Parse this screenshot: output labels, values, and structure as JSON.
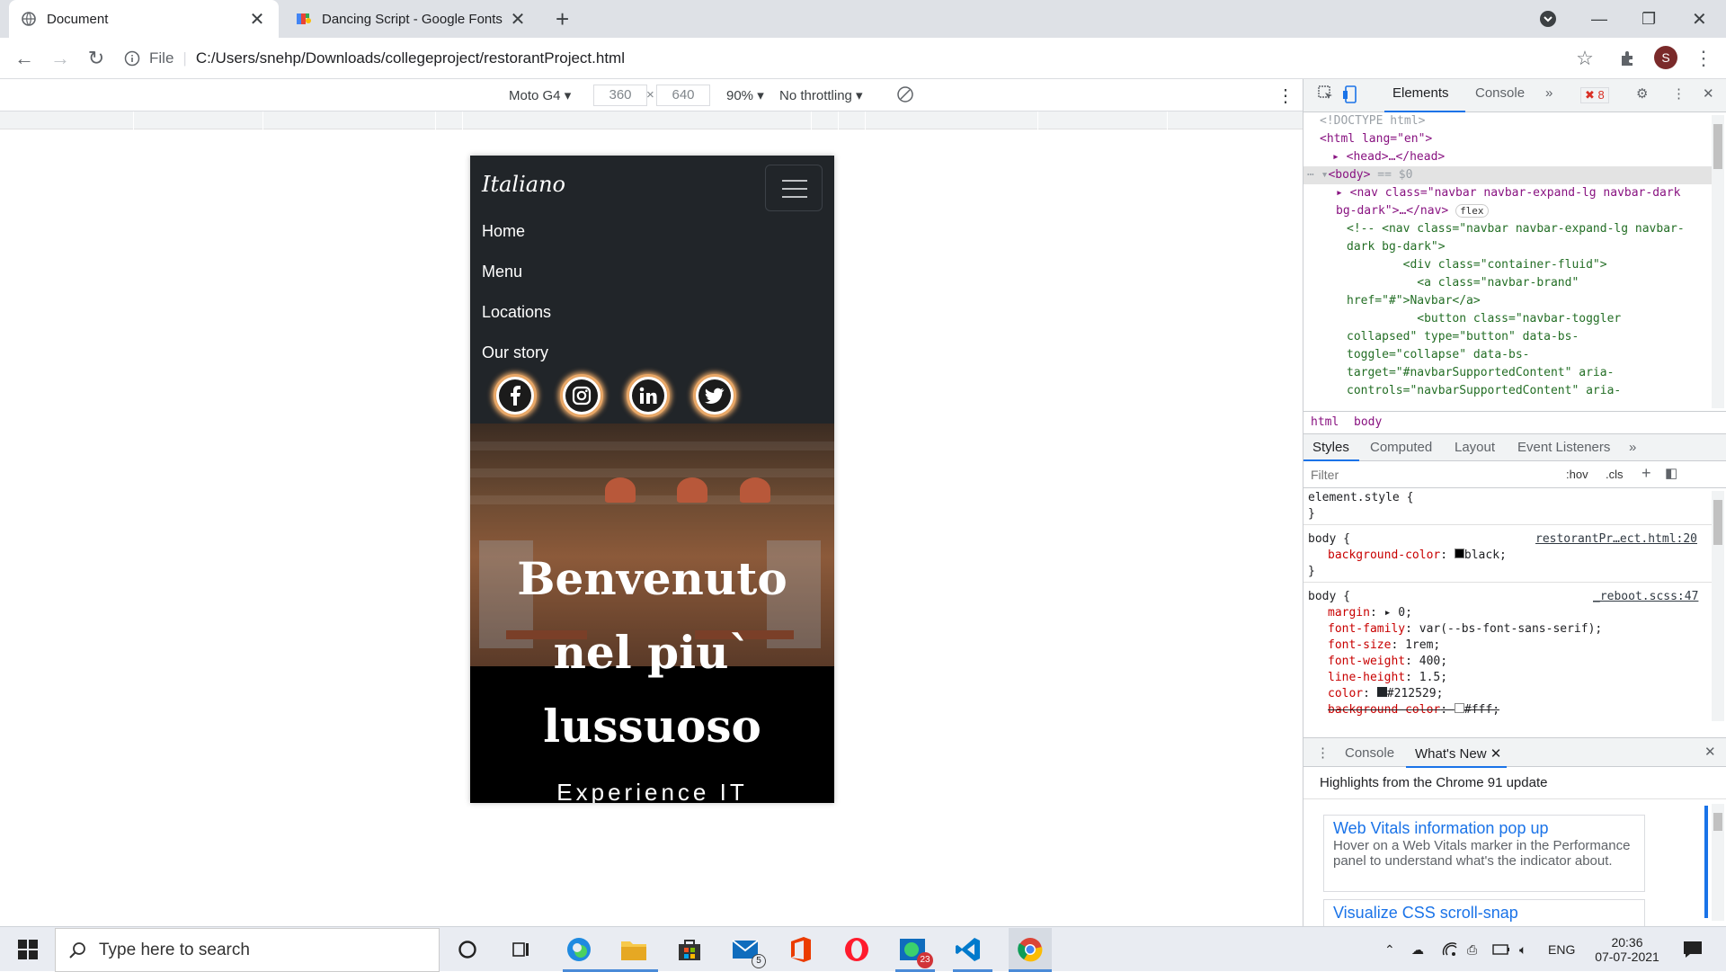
{
  "browser": {
    "tabs": [
      {
        "title": "Document",
        "active": true
      },
      {
        "title": "Dancing Script - Google Fonts",
        "active": false
      }
    ],
    "omnibox": {
      "scheme_label": "File",
      "url": "C:/Users/snehp/Downloads/collegeproject/restorantProject.html"
    },
    "profile_initial": "S"
  },
  "device_toolbar": {
    "device": "Moto G4",
    "width": "360",
    "times": "×",
    "height": "640",
    "zoom": "90%",
    "throttling": "No throttling"
  },
  "page": {
    "brand": "Italiano",
    "nav_links": [
      "Home",
      "Menu",
      "Locations",
      "Our story"
    ],
    "social": [
      "facebook-icon",
      "instagram-icon",
      "linkedin-icon",
      "twitter-icon"
    ],
    "hero_line1": "Benvenuto",
    "hero_line2": "nel piu`",
    "hero_line3": "lussuoso",
    "hero_sub": "Experience IT",
    "accent": "#e8a767"
  },
  "devtools": {
    "tabs": [
      "Elements",
      "Console"
    ],
    "error_count": "8",
    "dom": {
      "doctype": "<!DOCTYPE html>",
      "html_open": "<html lang=\"en\">",
      "head": "<head>…</head>",
      "body": "<body>",
      "body_ref": "== $0",
      "nav1": "<nav class=\"navbar navbar-expand-lg navbar-dark",
      "nav2": "bg-dark\">…</nav>",
      "flex_badge": "flex",
      "c1": "<!-- <nav class=\"navbar navbar-expand-lg navbar-",
      "c2": "dark bg-dark\">",
      "c3": "        <div class=\"container-fluid\">",
      "c4": "          <a class=\"navbar-brand\"",
      "c5": "href=\"#\">Navbar</a>",
      "c6": "          <button class=\"navbar-toggler",
      "c7": "collapsed\" type=\"button\" data-bs-",
      "c8": "toggle=\"collapse\" data-bs-",
      "c9": "target=\"#navbarSupportedContent\" aria-",
      "c10": "controls=\"navbarSupportedContent\" aria-"
    },
    "breadcrumb": [
      "html",
      "body"
    ],
    "style_tabs": [
      "Styles",
      "Computed",
      "Layout",
      "Event Listeners"
    ],
    "filter_placeholder": "Filter",
    "hov": ":hov",
    "cls": ".cls",
    "rules": {
      "element_style": "element.style {",
      "close": "}",
      "body1_sel": "body {",
      "body1_src": "restorantPr…ect.html:20",
      "body1_prop": "background-color",
      "body1_val": "black;",
      "body2_sel": "body {",
      "body2_src": "_reboot.scss:47",
      "p1": "margin",
      "v1": "0;",
      "p2": "font-family",
      "v2": "var(--bs-font-sans-serif);",
      "p3": "font-size",
      "v3": "1rem;",
      "p4": "font-weight",
      "v4": "400;",
      "p5": "line-height",
      "v5": "1.5;",
      "p6": "color",
      "v6": "#212529;",
      "p7": "background-color",
      "v7": "#fff;"
    },
    "drawer_tabs": [
      "Console",
      "What's New"
    ],
    "whatsnew_header": "Highlights from the Chrome 91 update",
    "cards": [
      {
        "title": "Web Vitals information pop up",
        "desc": "Hover on a Web Vitals marker in the Performance panel to understand what's the indicator about."
      },
      {
        "title": "Visualize CSS scroll-snap",
        "desc": ""
      }
    ]
  },
  "taskbar": {
    "search_placeholder": "Type here to search",
    "mail_badge": "5",
    "chat_badge": "23",
    "lang": "ENG",
    "time": "20:36",
    "date": "07-07-2021"
  }
}
